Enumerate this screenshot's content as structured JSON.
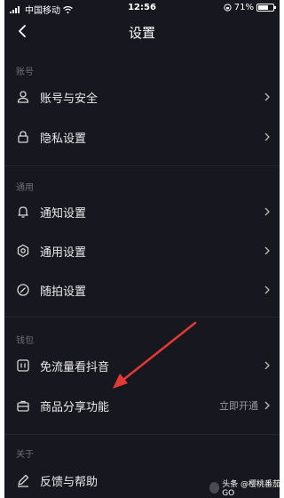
{
  "status_bar": {
    "carrier": "中国移动",
    "time": "12:56",
    "battery": "71%"
  },
  "nav": {
    "title": "设置"
  },
  "sections": {
    "account": {
      "header": "账号",
      "items": [
        {
          "label": "账号与安全"
        },
        {
          "label": "隐私设置"
        }
      ]
    },
    "general": {
      "header": "通用",
      "items": [
        {
          "label": "通知设置"
        },
        {
          "label": "通用设置"
        },
        {
          "label": "随拍设置"
        }
      ]
    },
    "wallet": {
      "header": "钱包",
      "items": [
        {
          "label": "免流量看抖音"
        },
        {
          "label": "商品分享功能",
          "value": "立即开通"
        }
      ]
    },
    "about": {
      "header": "关于",
      "items": [
        {
          "label": "反馈与帮助"
        }
      ]
    }
  },
  "watermark": {
    "text": "头条 @樱桃番茄GO"
  },
  "colors": {
    "background": "#17171f",
    "annotation_arrow": "#e53935"
  }
}
